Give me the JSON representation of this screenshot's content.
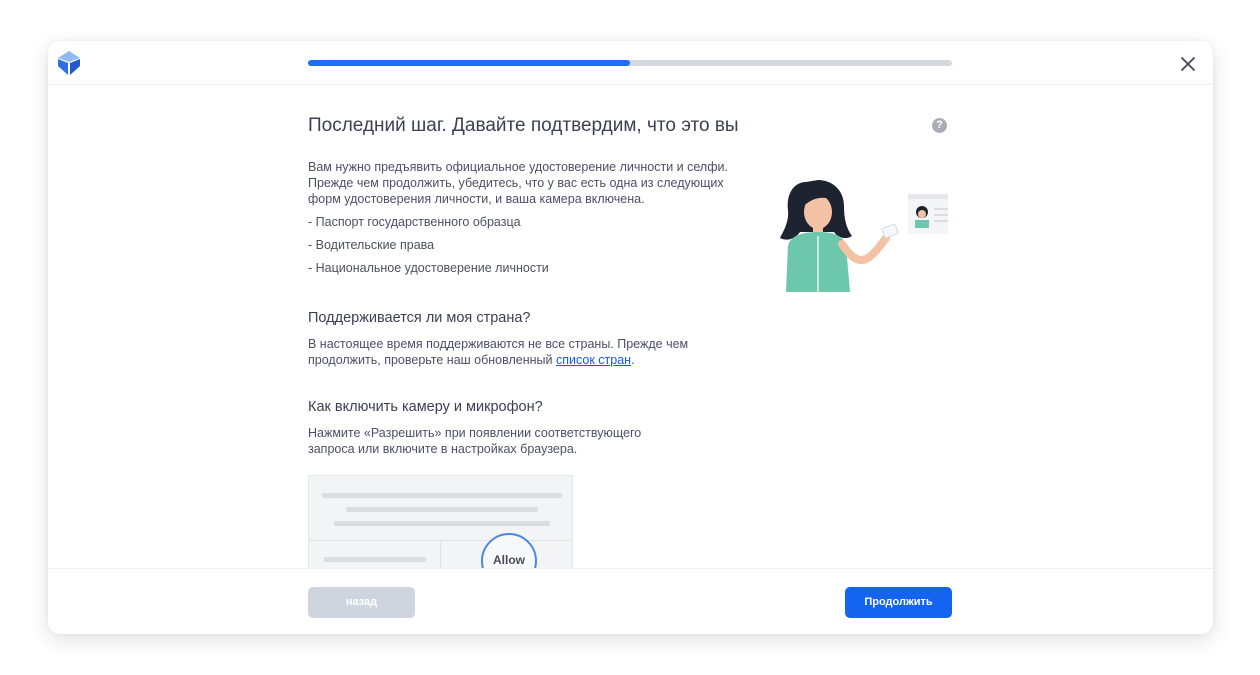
{
  "progress": {
    "fraction": 0.5
  },
  "brand": {
    "accent": "#1464f0",
    "logo_icon": "blockchain-cube-logo"
  },
  "main": {
    "title": "Последний шаг. Давайте подтвердим, что это вы",
    "intro": "Вам нужно предъявить официальное удостоверение личности и селфи. Прежде чем продолжить, убедитесь, что у вас есть одна из следующих форм удостоверения личности, и ваша камера включена.",
    "bullets": [
      "- Паспорт государственного образца",
      "- Водительские права",
      "- Национальное удостоверение личности"
    ],
    "country": {
      "heading": "Поддерживается ли моя страна?",
      "text_before": "В настоящее время поддерживаются не все страны. Прежде чем продолжить, проверьте наш обновленный ",
      "link": "список стран",
      "text_after": "."
    },
    "camera": {
      "heading": "Как включить камеру и микрофон?",
      "text": "Нажмите «Разрешить» при появлении соответствующего запроса или включите в настройках браузера.",
      "allow_label": "Allow"
    }
  },
  "footer": {
    "back_label": "назад",
    "continue_label": "Продолжить"
  }
}
